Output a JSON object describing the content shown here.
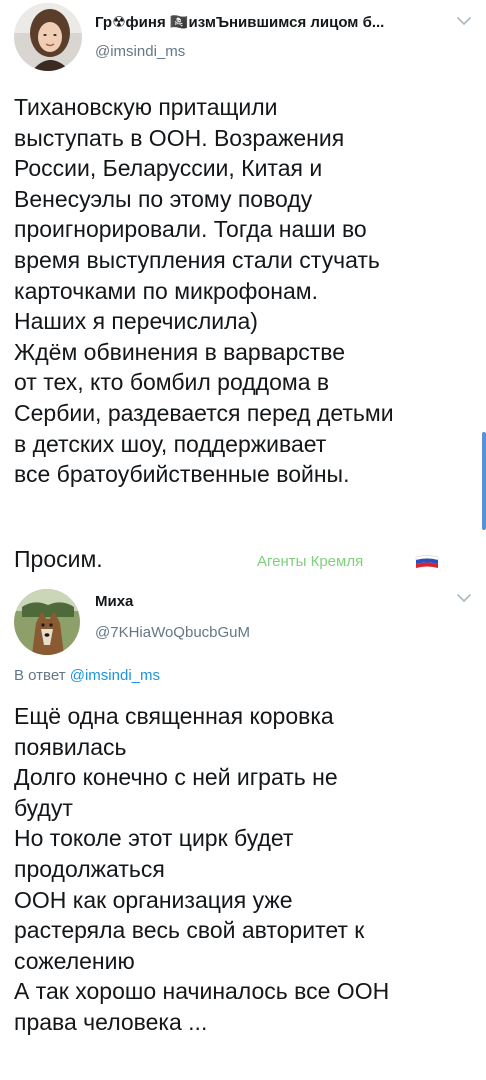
{
  "tweets": [
    {
      "author": {
        "display_name": "Гр☢финя 🏴‍☠️измЪнившимся лицом б...",
        "handle": "@imsindi_ms",
        "avatar": "woman-portrait-avatar"
      },
      "body_lines": [
        "Тихановскую притащили",
        "выступать в ООН. Возражения",
        "России, Беларуссии, Китая и",
        "Венесуэлы по этому поводу",
        "проигнорировали. Тогда наши во",
        "время выступления стали стучать",
        "карточками по микрофонам.",
        "Наших я перечислила)",
        "Ждём обвинения в варварстве",
        "от тех, кто бомбил роддома в",
        "Сербии, раздевается перед детьми",
        "в детских шоу, поддерживает",
        "все братоубийственные войны."
      ],
      "signoff": "Просим.",
      "tag": "Агенты Кремля",
      "tag_color": "#7ed07e",
      "flag": "russia-flag-icon"
    },
    {
      "author": {
        "display_name": "Миха",
        "handle": "@7KHiaWoQbucbGuM",
        "avatar": "dog-avatar"
      },
      "reply_prefix": "В ответ",
      "reply_mention": "@imsindi_ms",
      "body_lines": [
        "Ещё одна священная коровка",
        "появилась",
        "Долго конечно с ней играть не",
        "будут",
        "Но токоле этот цирк будет",
        "продолжаться",
        "ООН как организация уже",
        "растеряла весь свой авторитет к",
        "сожелению",
        "А так хорошо начиналось все ООН",
        "права человека ..."
      ]
    }
  ],
  "colors": {
    "text": "#14171a",
    "secondary": "#657786",
    "link": "#1b95e0",
    "scrollbar": "#5b8fd8"
  }
}
